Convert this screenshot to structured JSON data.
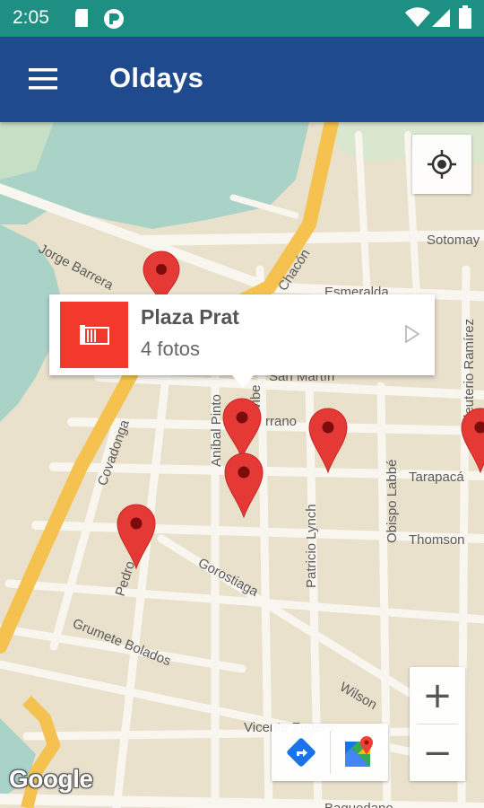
{
  "status_bar": {
    "time": "2:05",
    "icons": [
      "sd-card-icon",
      "notification-app-icon",
      "wifi-icon",
      "signal-icon",
      "battery-icon"
    ]
  },
  "app_bar": {
    "title": "Oldays",
    "menu_icon": "hamburger-menu-icon"
  },
  "map": {
    "street_labels": {
      "jorge_barrera": "Jorge Barrera",
      "chacon": "Chacón",
      "esmeralda": "Esmeralda",
      "sotomayor": "Sotomay",
      "san_martin": "San Martín",
      "serrano": "rrano",
      "anibal_pinto": "Aníbal Pinto",
      "covadonga": "Covadonga",
      "obispo_labbe": "Obispo Labbé",
      "tarapaca": "Tarapacá",
      "thomson": "Thomson",
      "patricio_lynch": "Patricio Lynch",
      "eleuterio_ramirez": "Eleuterio Ramírez",
      "pedro": "Pedro",
      "gorostiaga": "Gorostiaga",
      "grumete_bolados": "Grumete Bolados",
      "wilson": "Wilson",
      "vicente_zegers": "Vicente Zegers",
      "baquedano": "Baquedano",
      "vivar": "vibe"
    },
    "colors": {
      "land": "#e9e1cc",
      "water": "#aad3c8",
      "road_minor": "#f7f4ec",
      "road_major": "#f8c85a",
      "marker": "#e53935"
    },
    "marker_count": 6
  },
  "info_window": {
    "title": "Plaza Prat",
    "subtitle": "4 fotos",
    "thumb_icon": "photo-stack-icon",
    "arrow_icon": "play-arrow-icon"
  },
  "controls": {
    "locate_icon": "my-location-icon",
    "zoom_in": "+",
    "zoom_out": "−",
    "directions_icon": "directions-icon",
    "google_maps_icon": "google-maps-icon"
  },
  "attribution": "Google"
}
